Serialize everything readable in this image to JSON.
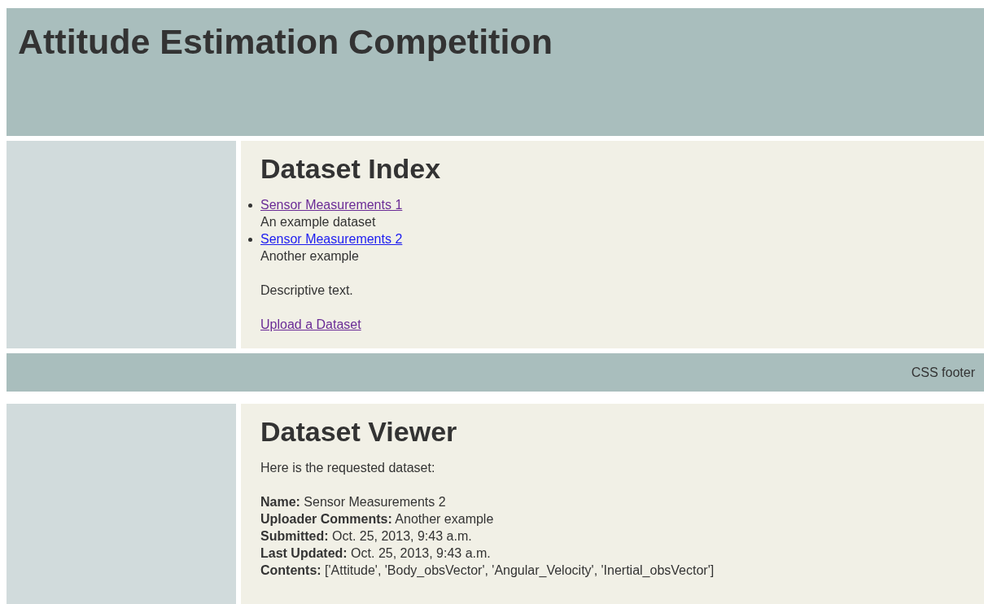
{
  "header": {
    "title": "Attitude Estimation Competition"
  },
  "index": {
    "heading": "Dataset Index",
    "datasets": [
      {
        "link": "Sensor Measurements 1",
        "visited": true,
        "description": "An example dataset"
      },
      {
        "link": "Sensor Measurements 2",
        "visited": false,
        "description": "Another example"
      }
    ],
    "text": "Descriptive text.",
    "upload_link": {
      "label": "Upload a Dataset",
      "visited": true
    }
  },
  "footer": {
    "text": "CSS footer"
  },
  "viewer": {
    "heading": "Dataset Viewer",
    "intro": "Here is the requested dataset:",
    "details": [
      "**Name:** Sensor Measurements 2",
      "**Uploader Comments:** Another example",
      "**Submitted:** Oct. 25, 2013, 9:43 a.m.",
      "**Last Updated:** Oct. 25, 2013, 9:43 a.m.",
      "**Contents:** ['Attitude', 'Body_obsVector', 'Angular_Velocity', 'Inertial_obsVector']"
    ]
  }
}
